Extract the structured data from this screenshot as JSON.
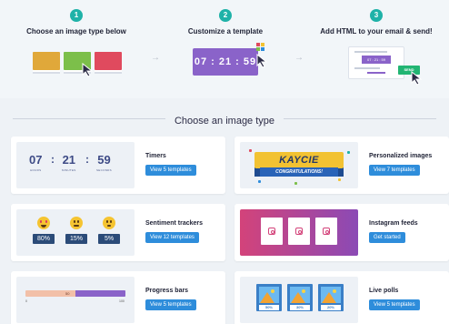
{
  "steps": [
    {
      "num": "1",
      "title": "Choose an image type below"
    },
    {
      "num": "2",
      "title": "Customize a template"
    },
    {
      "num": "3",
      "title": "Add HTML to your email & send!"
    }
  ],
  "step_arrow": "→",
  "step2_timer": "07 : 21 : 59",
  "step3_email_timer": "07 : 21 : 59",
  "step3_send": "SEND",
  "section_title": "Choose an image type",
  "cards": {
    "timers": {
      "name": "Timers",
      "button": "View 5 templates",
      "hours": "07",
      "minutes": "21",
      "seconds": "59",
      "hours_label": "HOURS",
      "minutes_label": "MINUTES",
      "seconds_label": "SECONDS",
      "sep": ":"
    },
    "personalized": {
      "name": "Personalized images",
      "button": "View 7 templates",
      "banner": "KAYCIE",
      "ribbon": "CONGRATULATIONS!"
    },
    "sentiment": {
      "name": "Sentiment trackers",
      "button": "View 12 templates",
      "values": [
        "80%",
        "15%",
        "5%"
      ]
    },
    "instagram": {
      "name": "Instagram feeds",
      "button": "Get started"
    },
    "progress": {
      "name": "Progress bars",
      "button": "View 5 templates",
      "min": "0",
      "mid": "50",
      "max": "100",
      "progress_fraction": 0.5
    },
    "polls": {
      "name": "Live polls",
      "button": "View 5 templates",
      "values": [
        "50%",
        "30%",
        "20%"
      ]
    }
  },
  "colors": {
    "accent_teal": "#1fb2a8",
    "button_blue": "#2e8ddb",
    "timer_purple": "#8a63c9",
    "thumb_orange": "#e0a83a",
    "thumb_green": "#7cbf4a",
    "thumb_red": "#e04a5e"
  },
  "icons": [
    "cursor-icon",
    "arrow-right-icon",
    "instagram-icon",
    "emoji-happy-icon",
    "emoji-neutral-icon",
    "emoji-sad-icon",
    "image-icon"
  ]
}
